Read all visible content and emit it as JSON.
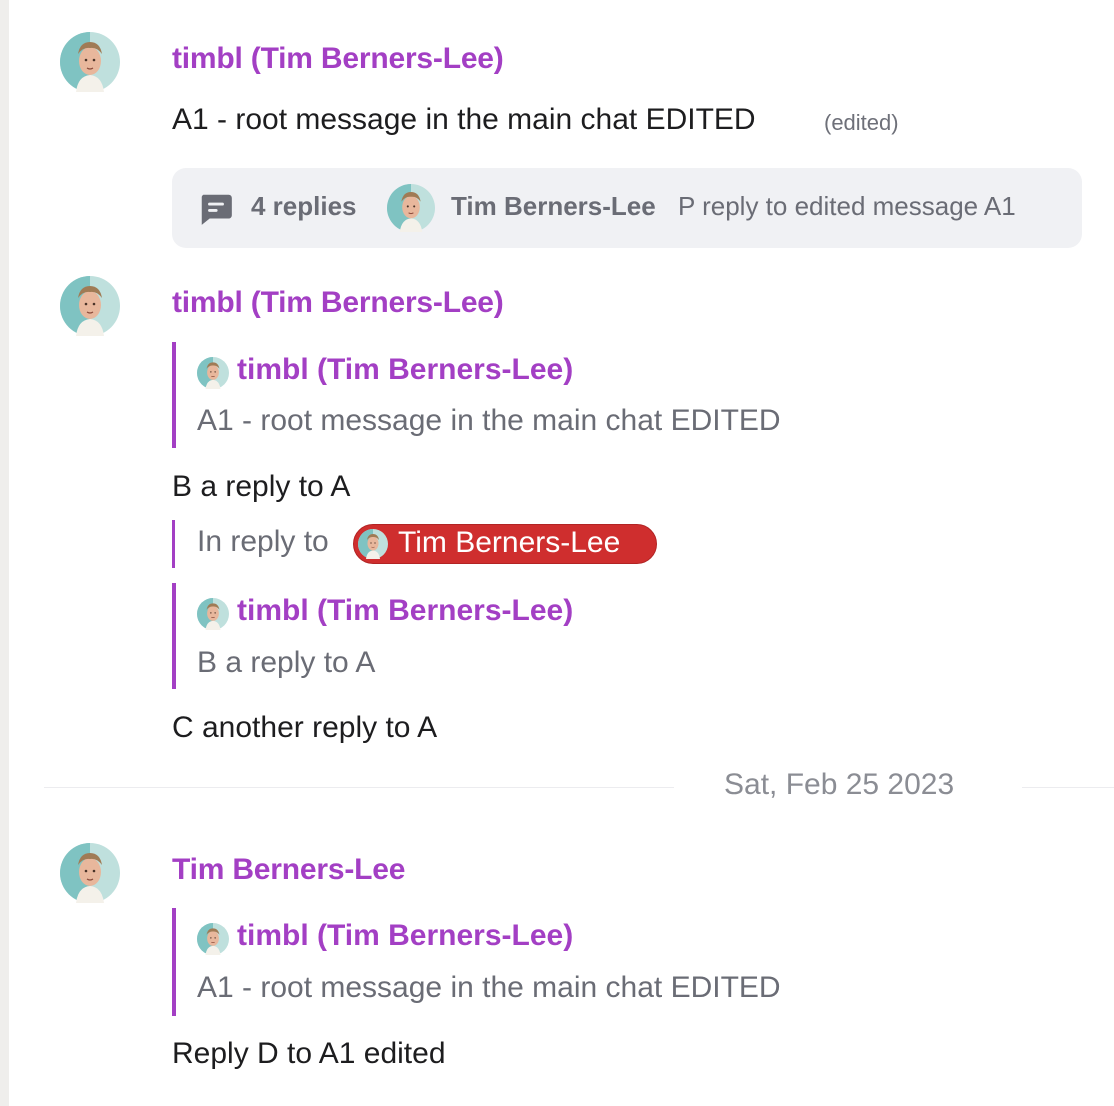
{
  "messages": [
    {
      "author": "timbl (Tim Berners-Lee)",
      "text": "A1 - root message in the main chat EDITED",
      "edited_label": "(edited)",
      "thread": {
        "replies_label": "4 replies",
        "last_reply_author": "Tim Berners-Lee",
        "last_reply_text": "P reply to edited message A1"
      }
    },
    {
      "author": "timbl (Tim Berners-Lee)",
      "quote": {
        "author": "timbl (Tim Berners-Lee)",
        "text": "A1 - root message in the main chat EDITED"
      },
      "text": "B a reply to A",
      "in_reply_label": "In reply to",
      "mention_name": "Tim Berners-Lee",
      "quote2": {
        "author": "timbl (Tim Berners-Lee)",
        "text": "B a reply to A"
      },
      "text2": "C another reply to A"
    },
    {
      "author": "Tim Berners-Lee",
      "quote": {
        "author": "timbl (Tim Berners-Lee)",
        "text": "A1 - root message in the main chat EDITED"
      },
      "text": "Reply D to A1 edited"
    }
  ],
  "date_separator": "Sat, Feb 25 2023",
  "icons": {
    "thread": "chat-bubble-icon",
    "avatar": "user-avatar-icon"
  },
  "colors": {
    "author": "#a33fc4",
    "mention_bg": "#cf2e2e",
    "thread_bg": "#f0f1f4"
  }
}
